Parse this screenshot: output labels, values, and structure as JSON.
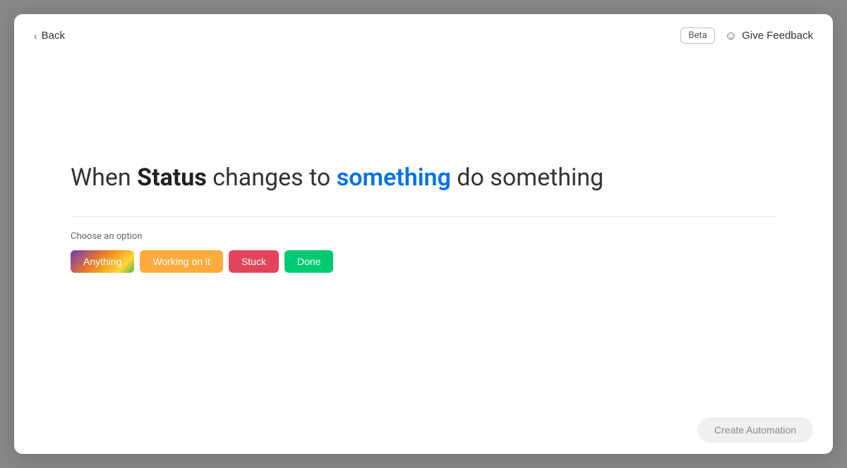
{
  "header": {
    "back_label": "Back",
    "beta_label": "Beta",
    "give_feedback_label": "Give Feedback"
  },
  "main": {
    "headline_part1": "When ",
    "headline_bold": "Status",
    "headline_part2": " changes to ",
    "headline_blue": "something",
    "headline_part3": " do something",
    "choose_label": "Choose an option",
    "options": [
      {
        "label": "Anything",
        "style": "anything"
      },
      {
        "label": "Working on it",
        "style": "working-on-it"
      },
      {
        "label": "Stuck",
        "style": "stuck"
      },
      {
        "label": "Done",
        "style": "done"
      }
    ]
  },
  "footer": {
    "create_automation_label": "Create Automation"
  },
  "colors": {
    "blue": "#0073ea",
    "anything_gradient_start": "#6c3cba",
    "anything_gradient_end": "#fdd835",
    "working_on_it": "#fdab3d",
    "stuck": "#e2445c",
    "done": "#00ca72"
  }
}
